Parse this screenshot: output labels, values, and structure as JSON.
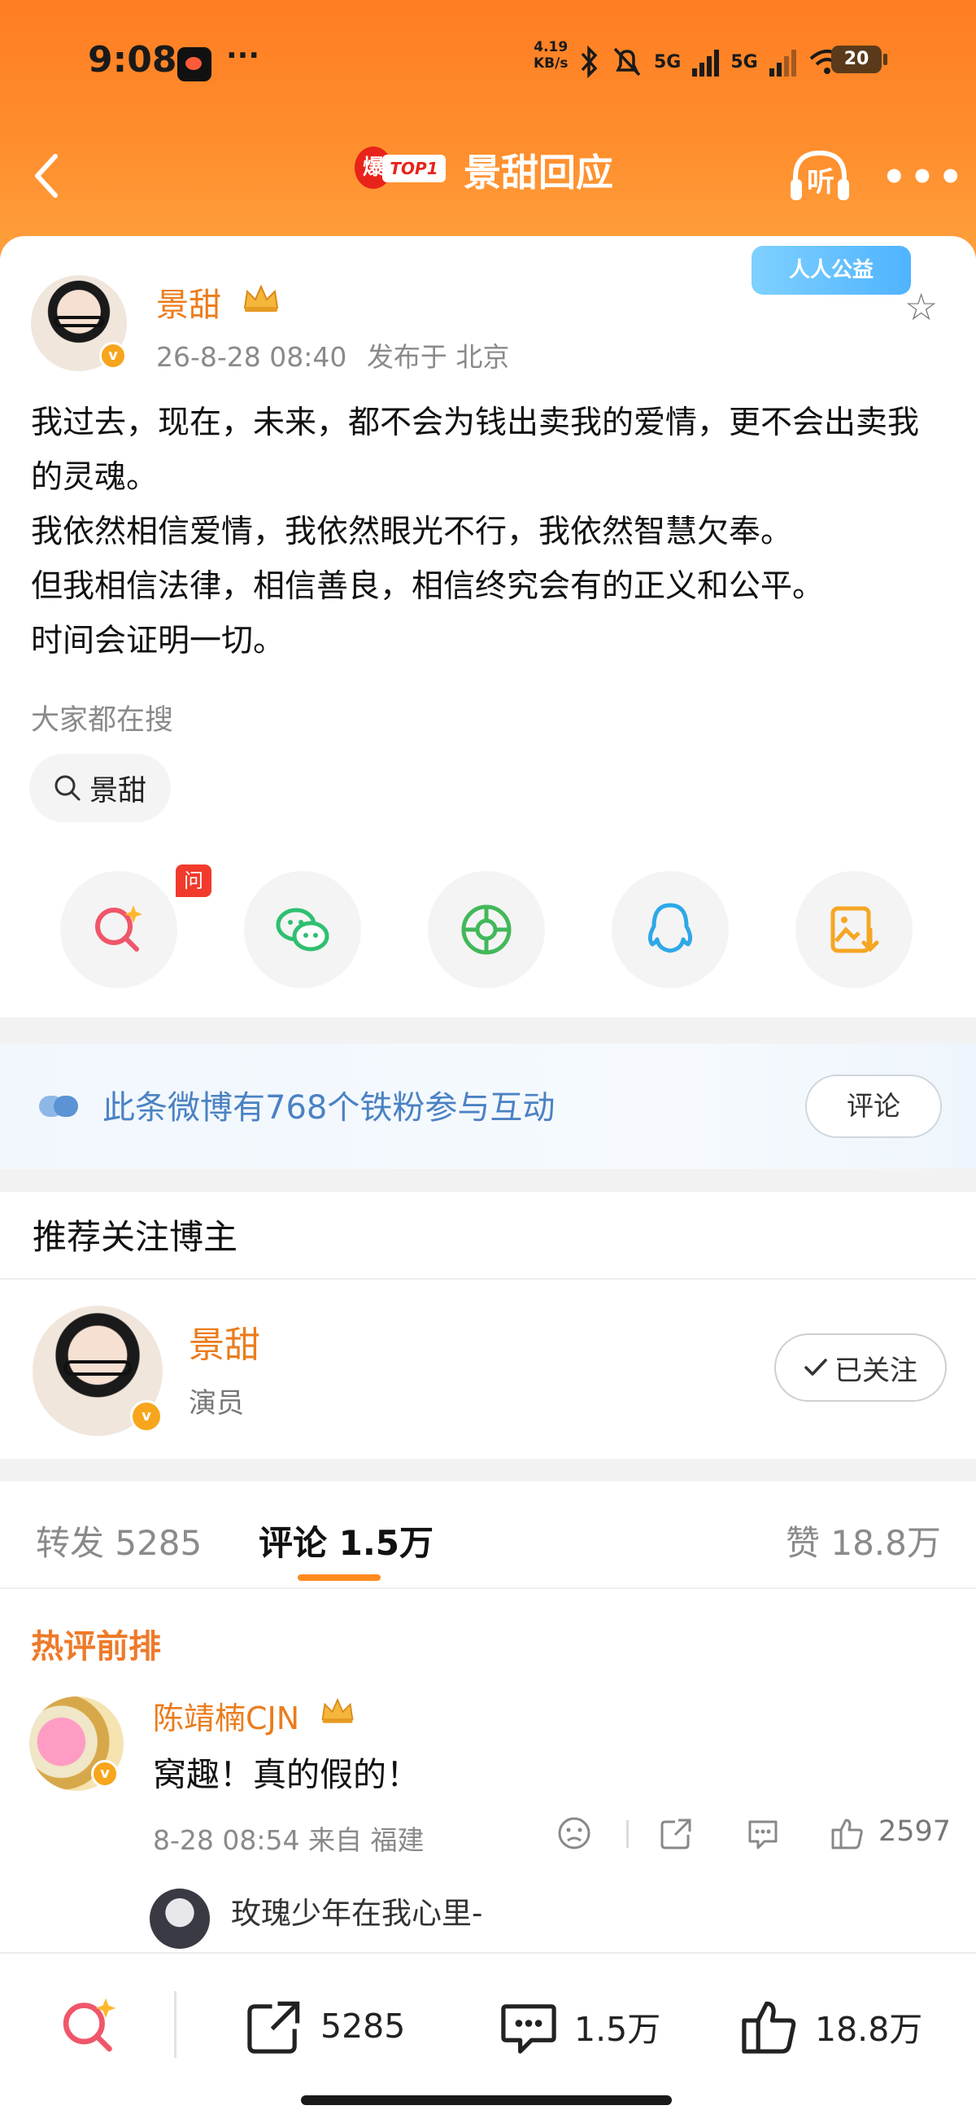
{
  "status_bar": {
    "time": "9:08",
    "more": "···",
    "net_speed_value": "4.19",
    "net_speed_unit": "KB/s",
    "signal_1": "5G",
    "signal_2": "5G",
    "battery": "20"
  },
  "navbar": {
    "hot_badge": "爆",
    "rank_badge": "TOP1",
    "title": "景甜回应",
    "listen_label": "听",
    "more_label": "•••"
  },
  "post": {
    "author": "景甜",
    "time": "26-8-28 08:40",
    "location": "发布于 北京",
    "campaign_badge": "人人公益",
    "lines": [
      "我过去，现在，未来，都不会为钱出卖我的爱情，更不会出卖我的灵魂。",
      "我依然相信爱情，我依然眼光不行，我依然智慧欠奉。",
      "但我相信法律，相信善良，相信终究会有的正义和公平。",
      "时间会证明一切。"
    ],
    "search_label": "大家都在搜",
    "search_chip": "景甜",
    "share_badge": "问智搜"
  },
  "fans_banner": {
    "text": "此条微博有768个铁粉参与互动",
    "button": "评论"
  },
  "recommend": {
    "title": "推荐关注博主",
    "name": "景甜",
    "subtitle": "演员",
    "follow_label": "已关注"
  },
  "tabs": {
    "repost": "转发 5285",
    "comments": "评论 1.5万",
    "likes": "赞 18.8万"
  },
  "comments": {
    "section_title": "热评前排",
    "first": {
      "user": "陈靖楠CJN",
      "text": "窝趣！真的假的！",
      "meta": "8-28 08:54  来自 福建",
      "likes": "2597"
    },
    "reply_user": "玫瑰少年在我心里-"
  },
  "bottom_bar": {
    "repost_count": "5285",
    "comment_count": "1.5万",
    "like_count": "18.8万"
  },
  "colors": {
    "brand_orange": "#ff8a1f",
    "name_orange": "#eb7c1c",
    "fans_blue": "#4b82c3"
  }
}
